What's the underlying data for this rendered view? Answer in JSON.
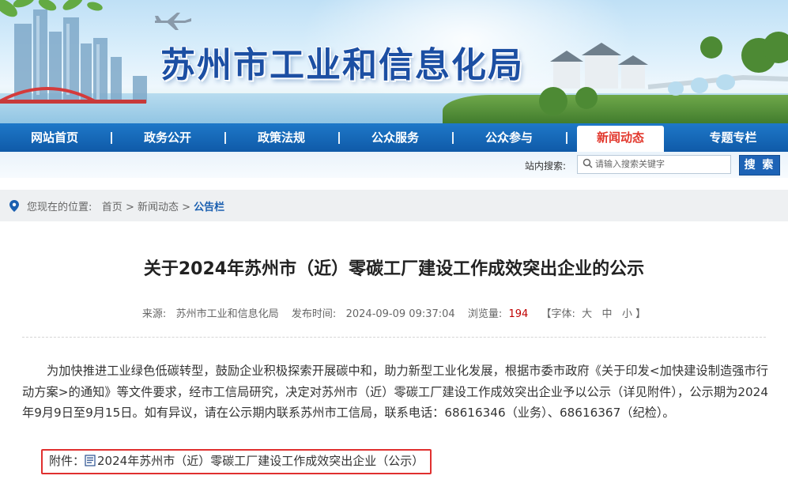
{
  "site": {
    "title": "苏州市工业和信息化局"
  },
  "nav": {
    "items": [
      {
        "label": "网站首页"
      },
      {
        "label": "政务公开"
      },
      {
        "label": "政策法规"
      },
      {
        "label": "公众服务"
      },
      {
        "label": "公众参与"
      },
      {
        "label": "新闻动态"
      },
      {
        "label": "专题专栏"
      }
    ],
    "active_index": 5,
    "active_color": "#e2372c",
    "bar_color": "#1467b8"
  },
  "search": {
    "label": "站内搜索:",
    "placeholder": "请输入搜索关键字",
    "button": "搜 索"
  },
  "breadcrumb": {
    "prefix": "您现在的位置:",
    "home": "首页",
    "sep1": " > ",
    "section": "新闻动态",
    "sep2": " > ",
    "current": "公告栏"
  },
  "article": {
    "title": "关于2024年苏州市（近）零碳工厂建设工作成效突出企业的公示",
    "meta": {
      "source_label": "来源:",
      "source": "苏州市工业和信息化局",
      "time_label": "发布时间:",
      "time": "2024-09-09 09:37:04",
      "views_label": "浏览量:",
      "views": "194",
      "font_label": "【字体:",
      "font_large": "大",
      "font_medium": "中",
      "font_small": "小",
      "font_end": "】"
    },
    "body": "为加快推进工业绿色低碳转型，鼓励企业积极探索开展碳中和，助力新型工业化发展，根据市委市政府《关于印发<加快建设制造强市行动方案>的通知》等文件要求，经市工信局研究，决定对苏州市（近）零碳工厂建设工作成效突出企业予以公示（详见附件），公示期为2024年9月9日至9月15日。如有异议，请在公示期内联系苏州市工信局，联系电话：68616346（业务）、68616367（纪检）。",
    "attachment_label": "附件：",
    "attachment_name": "2024年苏州市（近）零碳工厂建设工作成效突出企业（公示）",
    "attachment_icon": "doc-file-icon"
  }
}
